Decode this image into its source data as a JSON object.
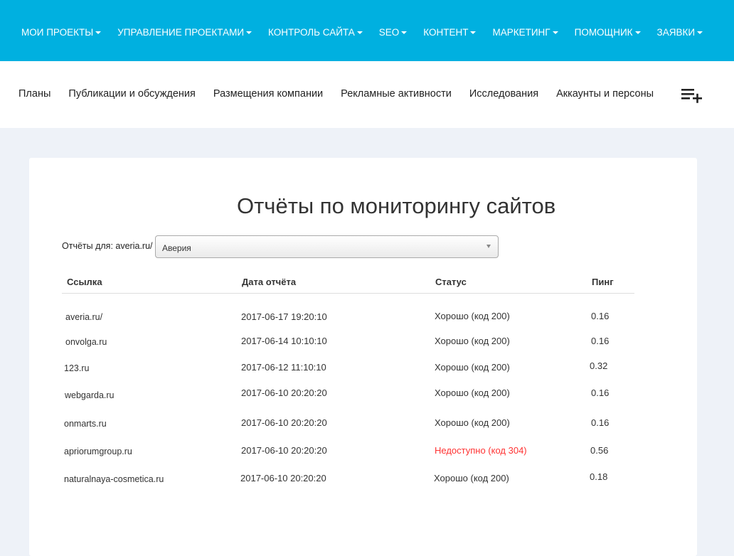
{
  "topnav": {
    "items": [
      {
        "label": "МОИ ПРОЕКТЫ"
      },
      {
        "label": "УПРАВЛЕНИЕ ПРОЕКТАМИ"
      },
      {
        "label": "КОНТРОЛЬ САЙТА"
      },
      {
        "label": "SEO"
      },
      {
        "label": "КОНТЕНТ"
      },
      {
        "label": "МАРКЕТИНГ"
      },
      {
        "label": "ПОМОЩНИК"
      },
      {
        "label": "ЗАЯВКИ"
      }
    ]
  },
  "subnav": {
    "items": [
      {
        "label": "Планы"
      },
      {
        "label": "Публикации и обсуждения"
      },
      {
        "label": "Размещения компании"
      },
      {
        "label": "Рекламные активности"
      },
      {
        "label": "Исследования"
      },
      {
        "label": "Аккаунты и персоны"
      }
    ],
    "add_icon": "playlist-add-icon"
  },
  "page": {
    "title": "Отчёты по мониторингу сайтов",
    "filter_label": "Отчёты для: averia.ru/",
    "select_value": "Аверия"
  },
  "table": {
    "headers": {
      "link": "Ссылка",
      "date": "Дата отчёта",
      "status": "Статус",
      "ping": "Пинг"
    },
    "rows": [
      {
        "link": "averia.ru/",
        "date": "2017-06-17 19:20:10",
        "status": "Хорошо (код 200)",
        "ping": "0.16",
        "ok": true
      },
      {
        "link": "onvolga.ru",
        "date": "2017-06-14 10:10:10",
        "status": "Хорошо (код 200)",
        "ping": "0.16",
        "ok": true
      },
      {
        "link": "123.ru",
        "date": "2017-06-12 11:10:10",
        "status": "Хорошо (код 200)",
        "ping": "0.32",
        "ok": true
      },
      {
        "link": "webgarda.ru",
        "date": "2017-06-10 20:20:20",
        "status": "Хорошо (код 200)",
        "ping": "0.16",
        "ok": true
      },
      {
        "link": "onmarts.ru",
        "date": "2017-06-10 20:20:20",
        "status": "Хорошо (код 200)",
        "ping": "0.16",
        "ok": true
      },
      {
        "link": "apriorumgroup.ru",
        "date": "2017-06-10 20:20:20",
        "status": "Недоступно (код 304)",
        "ping": "0.56",
        "ok": false
      },
      {
        "link": "naturalnaya-cosmetica.ru",
        "date": "2017-06-10 20:20:20",
        "status": "Хорошо (код 200)",
        "ping": "0.18",
        "ok": true
      }
    ]
  },
  "colors": {
    "topbar": "#00b0e0",
    "error": "#ff3333",
    "background": "#eef2f8"
  }
}
